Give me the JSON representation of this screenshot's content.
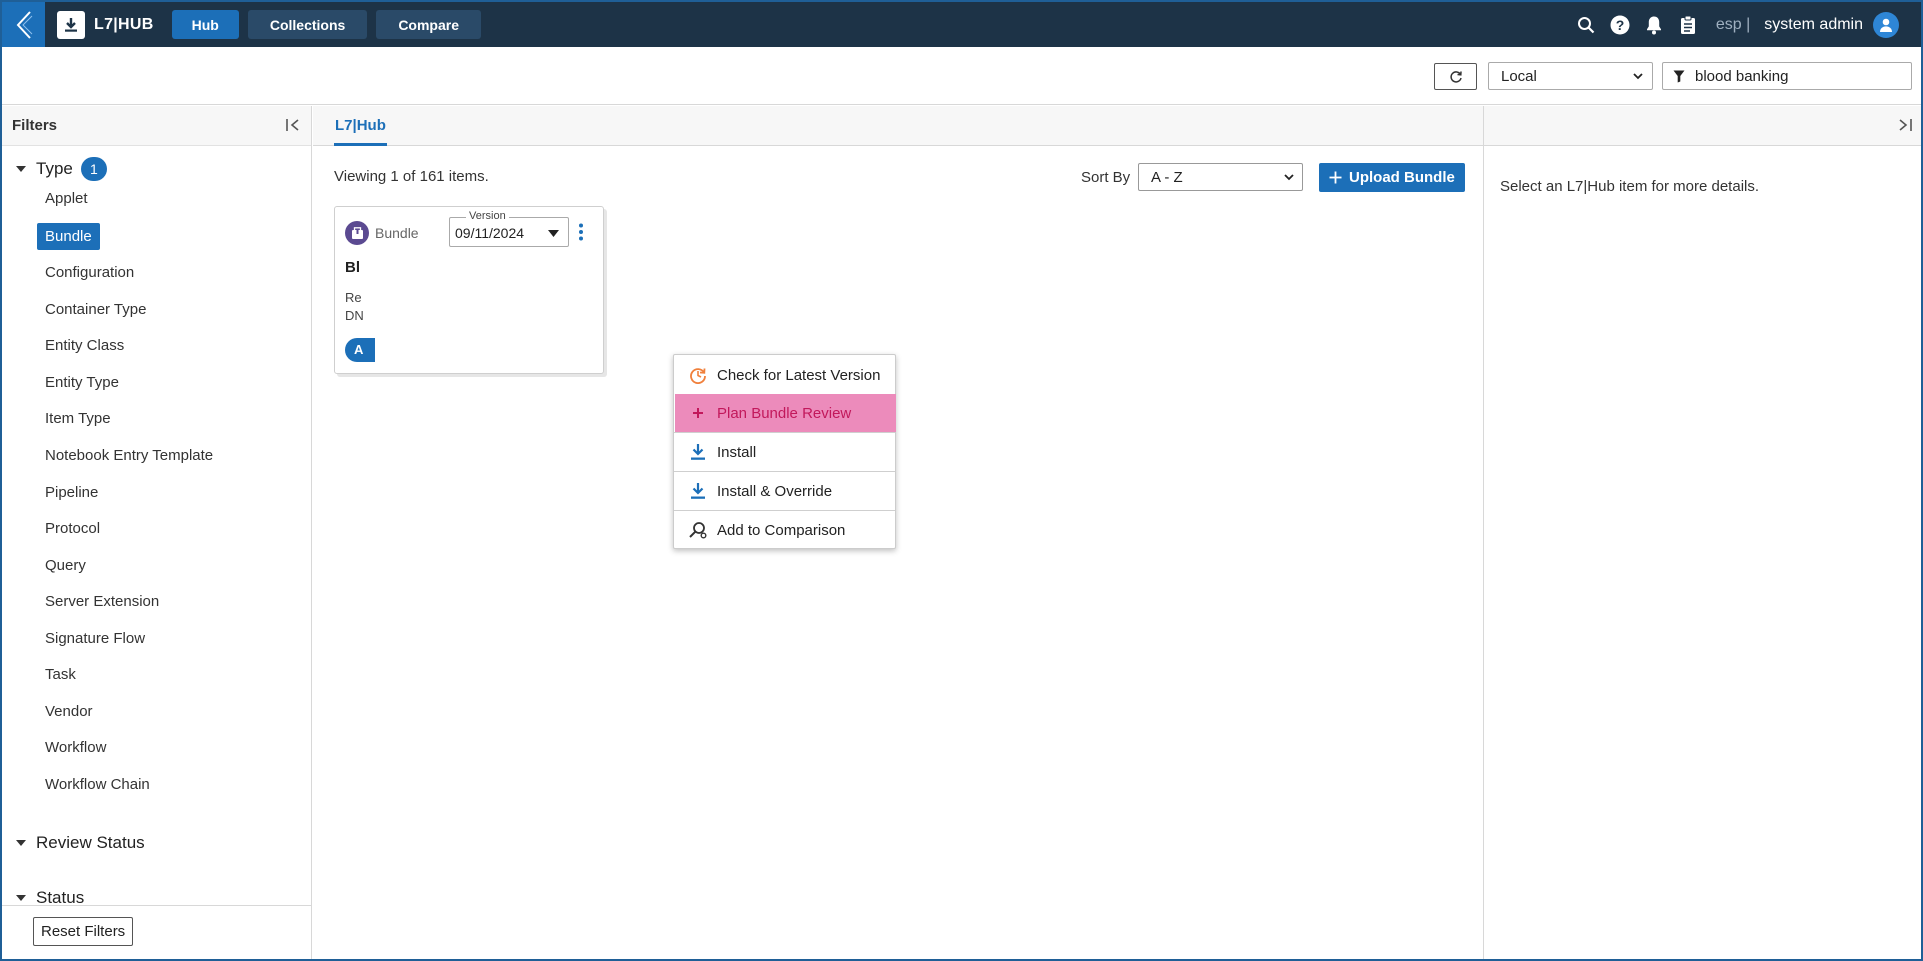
{
  "header": {
    "app_title": "L7|HUB",
    "nav": [
      "Hub",
      "Collections",
      "Compare"
    ],
    "tenant": "esp |",
    "user": "system admin"
  },
  "toolbar": {
    "environment": "Local",
    "search_value": "blood banking"
  },
  "filters": {
    "title": "Filters",
    "type_section": {
      "label": "Type",
      "count": "1"
    },
    "types": [
      "Applet",
      "Bundle",
      "Configuration",
      "Container Type",
      "Entity Class",
      "Entity Type",
      "Item Type",
      "Notebook Entry Template",
      "Pipeline",
      "Protocol",
      "Query",
      "Server Extension",
      "Signature Flow",
      "Task",
      "Vendor",
      "Workflow",
      "Workflow Chain"
    ],
    "selected_type": "Bundle",
    "review_status_label": "Review Status",
    "status_label": "Status",
    "reset_label": "Reset Filters"
  },
  "main": {
    "tab": "L7|Hub",
    "viewing": "Viewing 1 of 161 items.",
    "sort_label": "Sort By",
    "sort_value": "A - Z",
    "upload_label": "Upload Bundle",
    "card": {
      "type": "Bundle",
      "version_label": "Version",
      "version_value": "09/11/2024",
      "title": "Bl",
      "desc_line1": "Re",
      "desc_line2": "DN",
      "button": "A"
    },
    "menu": [
      {
        "label": "Check for Latest Version",
        "icon": "refresh-clock-icon"
      },
      {
        "label": "Plan Bundle Review",
        "icon": "plus-icon"
      },
      {
        "label": "Install",
        "icon": "download-icon"
      },
      {
        "label": "Install & Override",
        "icon": "download-icon"
      },
      {
        "label": "Add to Comparison",
        "icon": "compare-search-icon"
      }
    ]
  },
  "details": {
    "message": "Select an L7|Hub item for more details."
  },
  "colors": {
    "topbar": "#1d3347",
    "accent": "#1c6fb8",
    "menu_highlight": "#ec8bbb",
    "bundle_badge": "#5b4a91"
  }
}
